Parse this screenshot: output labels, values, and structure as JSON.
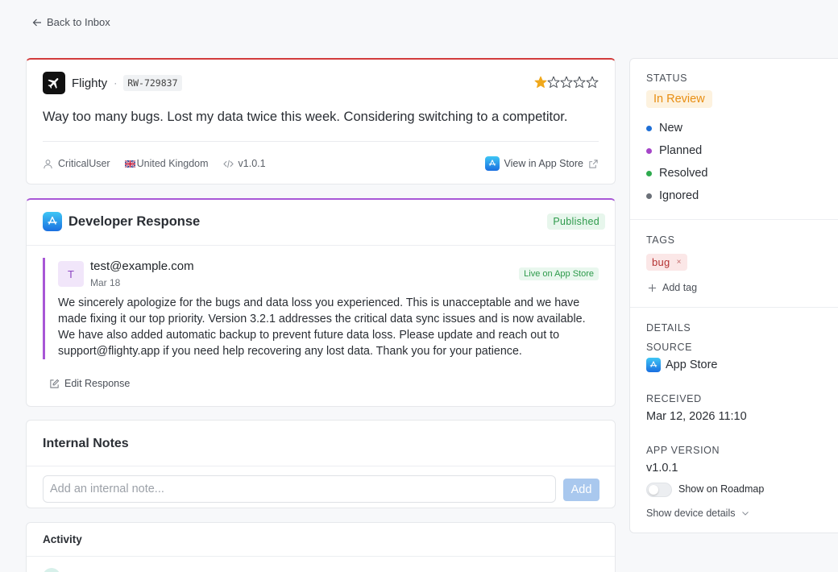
{
  "nav": {
    "back_label": "Back to Inbox"
  },
  "review": {
    "app_name": "Flighty",
    "review_id": "RW-729837",
    "rating": 1,
    "max_rating": 5,
    "text": "Way too many bugs. Lost my data twice this week. Considering switching to a competitor.",
    "author": "CriticalUser",
    "country": "United Kingdom",
    "version": "v1.0.1",
    "store_link": "View in App Store"
  },
  "response": {
    "title": "Developer Response",
    "status": "Published",
    "author_initial": "T",
    "author_email": "test@example.com",
    "date": "Mar 18",
    "live_badge": "Live on App Store",
    "text": "We sincerely apologize for the bugs and data loss you experienced. This is unacceptable and we have made fixing it our top priority. Version 3.2.1 addresses the critical data sync issues and is now available. We have also added automatic backup to prevent future data loss. Please update and reach out to support@flighty.app if you need help recovering any lost data. Thank you for your patience.",
    "edit_label": "Edit Response"
  },
  "notes": {
    "title": "Internal Notes",
    "placeholder": "Add an internal note...",
    "add_label": "Add"
  },
  "activity": {
    "title": "Activity"
  },
  "sidebar": {
    "status_label": "STATUS",
    "current_status": "In Review",
    "status_options": [
      {
        "label": "New",
        "color": "#1f6fd6"
      },
      {
        "label": "Planned",
        "color": "#a545c8"
      },
      {
        "label": "Resolved",
        "color": "#2eaa4e"
      },
      {
        "label": "Ignored",
        "color": "#6b7078"
      }
    ],
    "tags_label": "TAGS",
    "tags": [
      "bug"
    ],
    "add_tag_label": "Add tag",
    "details_label": "DETAILS",
    "source_label": "SOURCE",
    "source_value": "App Store",
    "received_label": "RECEIVED",
    "received_value": "Mar 12, 2026 11:10",
    "app_version_label": "APP VERSION",
    "app_version_value": "v1.0.1",
    "roadmap_label": "Show on Roadmap",
    "device_details_label": "Show device details"
  },
  "colors": {
    "review_border": "#d23b3b",
    "response_border": "#a857d6",
    "star": "#f0a81c",
    "status_badge": "#e88e12"
  }
}
